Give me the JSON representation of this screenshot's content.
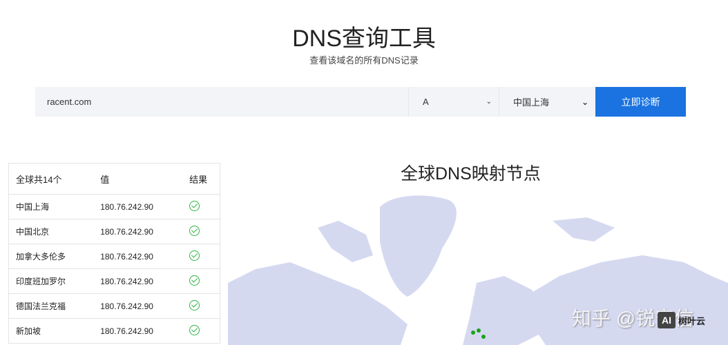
{
  "header": {
    "title": "DNS查询工具",
    "subtitle": "查看该域名的所有DNS记录"
  },
  "search": {
    "domain": "racent.com",
    "record_type": "A",
    "location": "中国上海",
    "submit": "立即诊断"
  },
  "table": {
    "headers": [
      "全球共14个",
      "值",
      "结果"
    ],
    "rows": [
      {
        "location": "中国上海",
        "value": "180.76.242.90"
      },
      {
        "location": "中国北京",
        "value": "180.76.242.90"
      },
      {
        "location": "加拿大多伦多",
        "value": "180.76.242.90"
      },
      {
        "location": "印度班加罗尔",
        "value": "180.76.242.90"
      },
      {
        "location": "德国法兰克福",
        "value": "180.76.242.90"
      },
      {
        "location": "新加坡",
        "value": "180.76.242.90"
      }
    ]
  },
  "map": {
    "title": "全球DNS映射节点",
    "land_color": "#d5d9f0",
    "node_color": "#1aa31a"
  },
  "watermark": {
    "text": "知乎 @锐安信",
    "logo": "AI",
    "logo_text": "树叶云"
  }
}
